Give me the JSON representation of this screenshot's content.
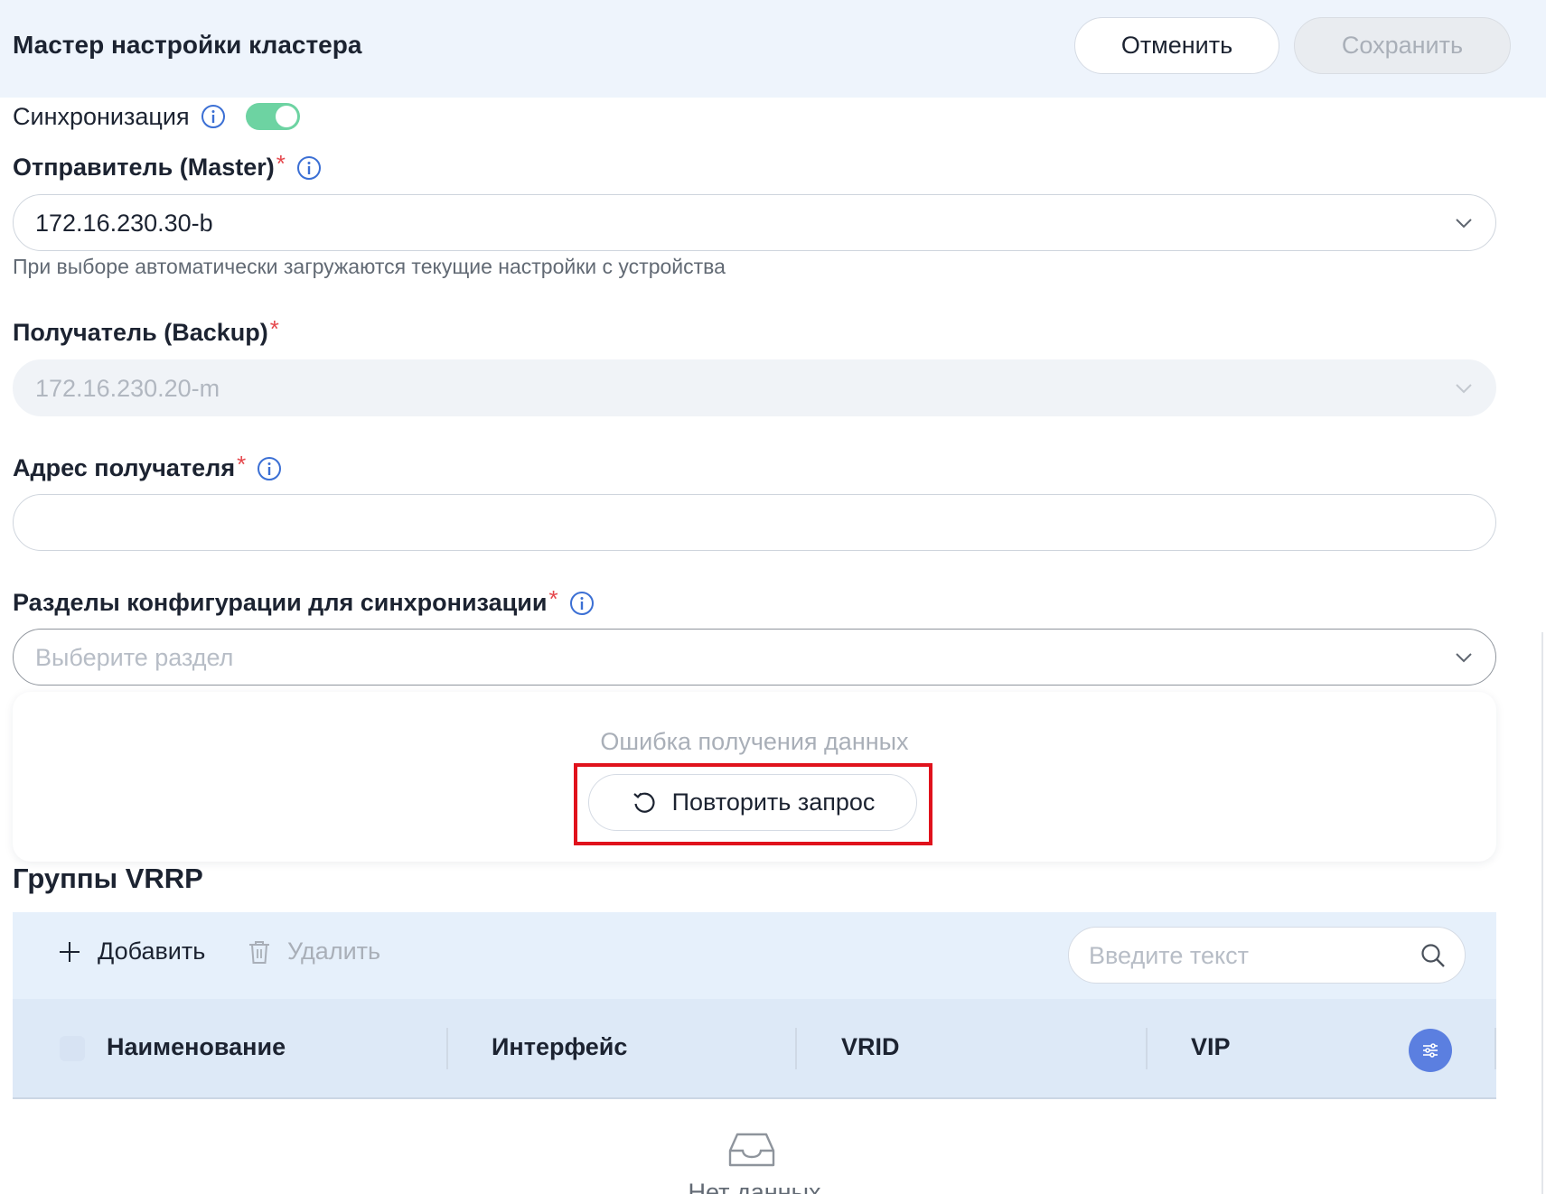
{
  "header": {
    "title": "Мастер настройки кластера",
    "cancel_label": "Отменить",
    "save_label": "Сохранить"
  },
  "sync": {
    "label": "Синхронизация",
    "enabled": true
  },
  "master": {
    "label": "Отправитель (Master)",
    "required_mark": "*",
    "value": "172.16.230.30-b",
    "hint": "При выборе автоматически загружаются текущие настройки с устройства"
  },
  "backup": {
    "label": "Получатель (Backup)",
    "required_mark": "*",
    "value": "172.16.230.20-m"
  },
  "recipient_address": {
    "label": "Адрес получателя",
    "required_mark": "*",
    "value": ""
  },
  "config_sections": {
    "label": "Разделы конфигурации для синхронизации",
    "required_mark": "*",
    "placeholder": "Выберите раздел",
    "error_text": "Ошибка получения данных",
    "retry_label": "Повторить запрос"
  },
  "vrrp": {
    "title": "Группы VRRP",
    "add_label": "Добавить",
    "delete_label": "Удалить",
    "search_placeholder": "Введите текст",
    "columns": [
      "Наименование",
      "Интерфейс",
      "VRID",
      "VIP"
    ],
    "rows": [],
    "empty_text": "Нет данных"
  },
  "colors": {
    "header_bg": "#eef4fc",
    "toggle_on": "#6dd3a2",
    "required": "#e5484d",
    "info_icon": "#3b6fd4",
    "highlight": "#e0121c",
    "settings_button": "#5b7fe0"
  },
  "icons": {
    "info": "info-icon",
    "chevron": "chevron-down-icon",
    "retry": "refresh-icon",
    "add": "plus-icon",
    "delete": "trash-icon",
    "search": "search-icon",
    "column_settings": "sliders-icon",
    "empty": "inbox-icon"
  }
}
